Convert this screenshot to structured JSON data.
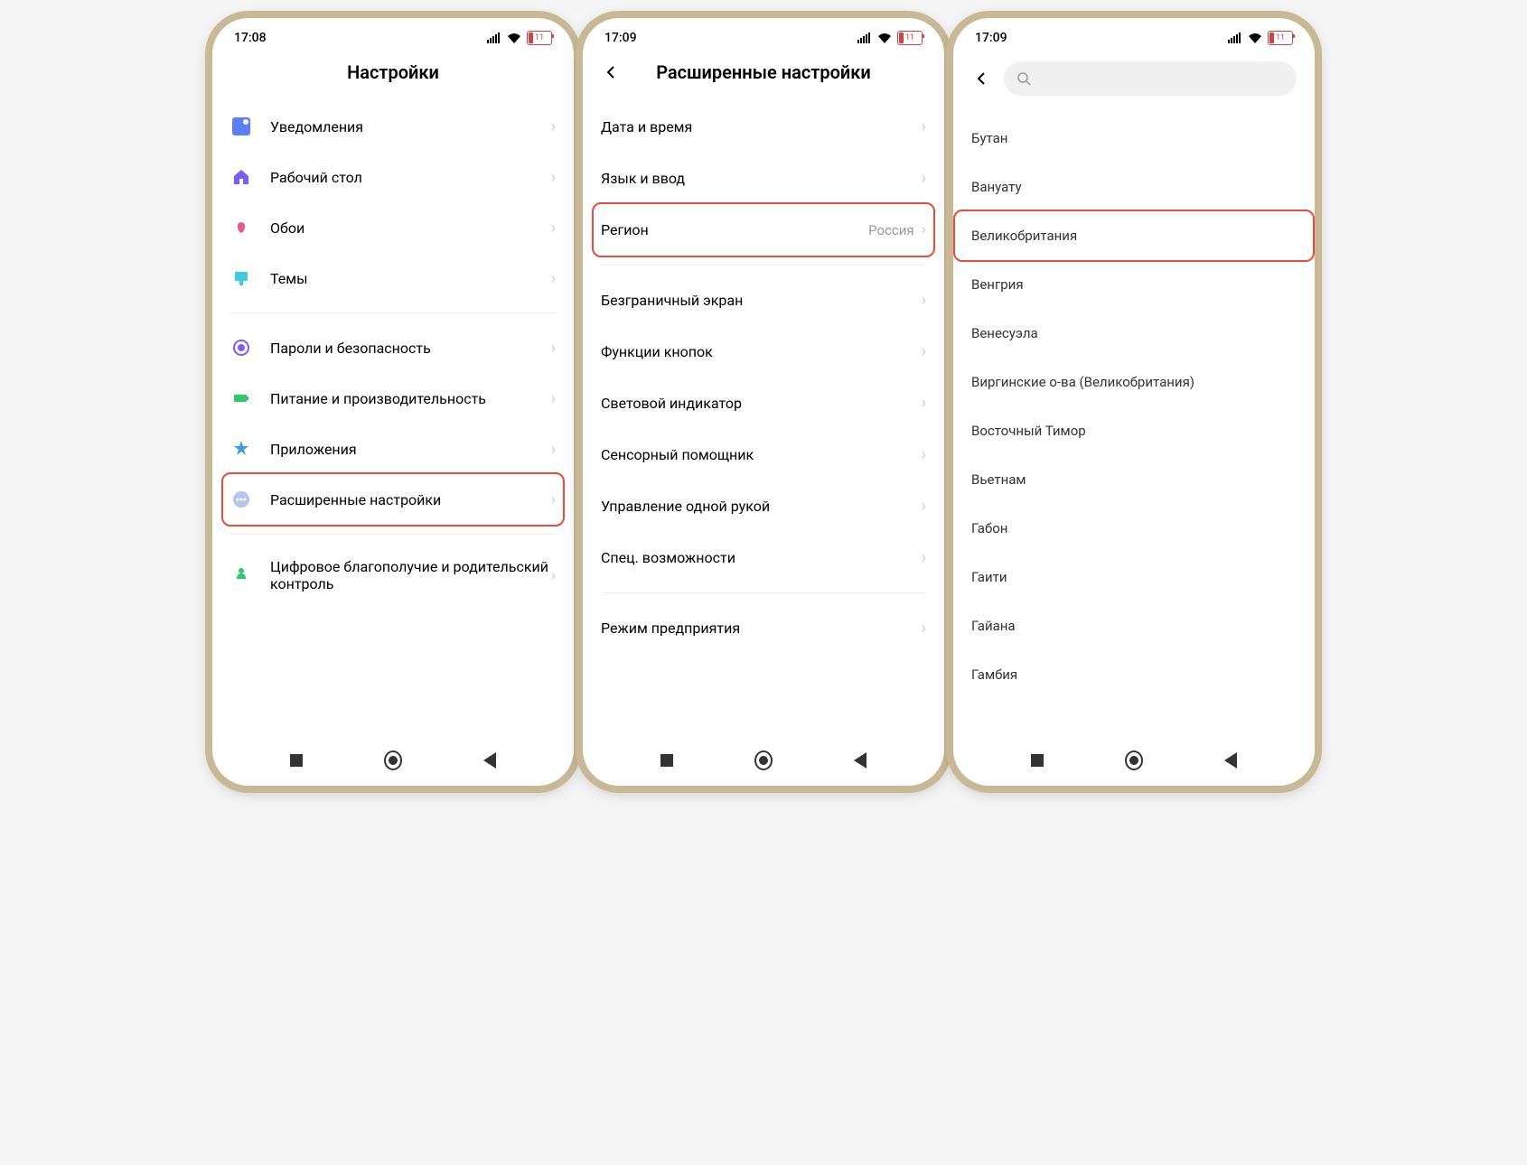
{
  "status": {
    "time1": "17:08",
    "time2": "17:09",
    "time3": "17:09",
    "battery": "11"
  },
  "phone1": {
    "title": "Настройки",
    "items": [
      {
        "label": "Уведомления"
      },
      {
        "label": "Рабочий стол"
      },
      {
        "label": "Обои"
      },
      {
        "label": "Темы"
      },
      {
        "label": "Пароли и безопасность"
      },
      {
        "label": "Питание и производительность"
      },
      {
        "label": "Приложения"
      },
      {
        "label": "Расширенные настройки"
      },
      {
        "label": "Цифровое благополучие и родительский контроль"
      }
    ]
  },
  "phone2": {
    "title": "Расширенные настройки",
    "items": [
      {
        "label": "Дата и время"
      },
      {
        "label": "Язык и ввод"
      },
      {
        "label": "Регион",
        "value": "Россия"
      },
      {
        "label": "Безграничный экран"
      },
      {
        "label": "Функции кнопок"
      },
      {
        "label": "Световой индикатор"
      },
      {
        "label": "Сенсорный помощник"
      },
      {
        "label": "Управление одной рукой"
      },
      {
        "label": "Спец. возможности"
      },
      {
        "label": "Режим предприятия"
      }
    ]
  },
  "phone3": {
    "regions": [
      "Бутан",
      "Вануату",
      "Великобритания",
      "Венгрия",
      "Венесуэла",
      "Виргинские о-ва (Великобритания)",
      "Восточный Тимор",
      "Вьетнам",
      "Габон",
      "Гаити",
      "Гайана",
      "Гамбия"
    ]
  }
}
